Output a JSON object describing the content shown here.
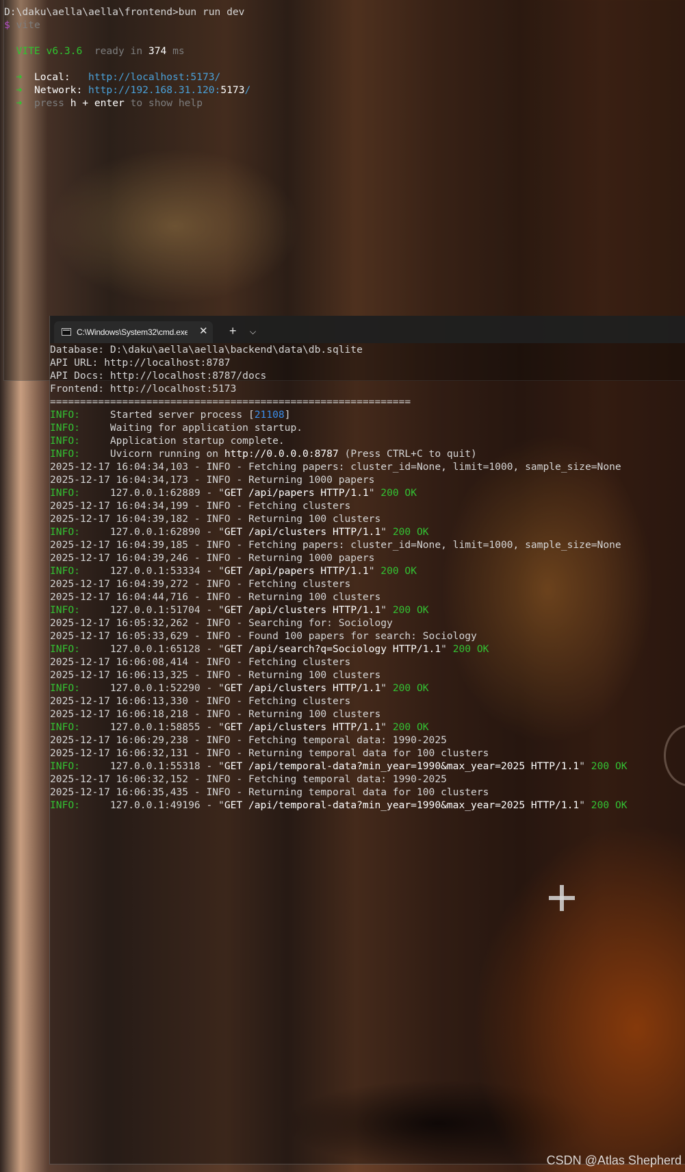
{
  "terminal_vite": {
    "command_line": "D:\\daku\\aella\\aella\\frontend>bun run dev",
    "script": {
      "symbol": "$",
      "name": "vite"
    },
    "ready": {
      "name": "VITE",
      "version": "v6.3.6",
      "text": "ready in",
      "ms": "374",
      "unit": "ms"
    },
    "arrow": "➜",
    "local": {
      "label": "Local:",
      "url": "http://localhost:5173/"
    },
    "network": {
      "label": "Network:",
      "url_host": "http://192.168.31.120:",
      "url_port": "5173",
      "url_slash": "/"
    },
    "help": {
      "press": "press",
      "keys": "h + enter",
      "rest": "to show help"
    }
  },
  "terminal_backend": {
    "tab": {
      "title": "C:\\Windows\\System32\\cmd.exe",
      "icon": "cmd-icon",
      "close": "✕"
    },
    "new_tab": "+",
    "dropdown": "⌵",
    "header_lines": [
      "Database: D:\\daku\\aella\\aella\\backend\\data\\db.sqlite",
      "API URL: http://localhost:8787",
      "API Docs: http://localhost:8787/docs",
      "Frontend: http://localhost:5173",
      "============================================================"
    ],
    "startup": {
      "level": "INFO:",
      "started_pre": "Started server process [",
      "pid": "21108",
      "started_post": "]",
      "waiting": "Waiting for application startup.",
      "complete": "Application startup complete.",
      "uvicorn_pre": "Uvicorn running on ",
      "uvicorn_url": "http://0.0.0.0:8787",
      "uvicorn_post": " (Press CTRL+C to quit)"
    },
    "log_lines": [
      {
        "type": "log",
        "text": "2025-12-17 16:04:34,103 - INFO - Fetching papers: cluster_id=None, limit=1000, sample_size=None"
      },
      {
        "type": "log",
        "text": "2025-12-17 16:04:34,173 - INFO - Returning 1000 papers"
      },
      {
        "type": "req",
        "level": "INFO:",
        "addr": "127.0.0.1:62889 - \"",
        "request": "GET /api/papers HTTP/1.1",
        "quote": "\"",
        "status": "200 OK"
      },
      {
        "type": "log",
        "text": "2025-12-17 16:04:34,199 - INFO - Fetching clusters"
      },
      {
        "type": "log",
        "text": "2025-12-17 16:04:39,182 - INFO - Returning 100 clusters"
      },
      {
        "type": "req",
        "level": "INFO:",
        "addr": "127.0.0.1:62890 - \"",
        "request": "GET /api/clusters HTTP/1.1",
        "quote": "\"",
        "status": "200 OK"
      },
      {
        "type": "log",
        "text": "2025-12-17 16:04:39,185 - INFO - Fetching papers: cluster_id=None, limit=1000, sample_size=None"
      },
      {
        "type": "log",
        "text": "2025-12-17 16:04:39,246 - INFO - Returning 1000 papers"
      },
      {
        "type": "req",
        "level": "INFO:",
        "addr": "127.0.0.1:53334 - \"",
        "request": "GET /api/papers HTTP/1.1",
        "quote": "\"",
        "status": "200 OK"
      },
      {
        "type": "log",
        "text": "2025-12-17 16:04:39,272 - INFO - Fetching clusters"
      },
      {
        "type": "log",
        "text": "2025-12-17 16:04:44,716 - INFO - Returning 100 clusters"
      },
      {
        "type": "req",
        "level": "INFO:",
        "addr": "127.0.0.1:51704 - \"",
        "request": "GET /api/clusters HTTP/1.1",
        "quote": "\"",
        "status": "200 OK"
      },
      {
        "type": "log",
        "text": "2025-12-17 16:05:32,262 - INFO - Searching for: Sociology"
      },
      {
        "type": "log",
        "text": "2025-12-17 16:05:33,629 - INFO - Found 100 papers for search: Sociology"
      },
      {
        "type": "req",
        "level": "INFO:",
        "addr": "127.0.0.1:65128 - \"",
        "request": "GET /api/search?q=Sociology HTTP/1.1",
        "quote": "\"",
        "status": "200 OK"
      },
      {
        "type": "log",
        "text": "2025-12-17 16:06:08,414 - INFO - Fetching clusters"
      },
      {
        "type": "log",
        "text": "2025-12-17 16:06:13,325 - INFO - Returning 100 clusters"
      },
      {
        "type": "req",
        "level": "INFO:",
        "addr": "127.0.0.1:52290 - \"",
        "request": "GET /api/clusters HTTP/1.1",
        "quote": "\"",
        "status": "200 OK"
      },
      {
        "type": "log",
        "text": "2025-12-17 16:06:13,330 - INFO - Fetching clusters"
      },
      {
        "type": "log",
        "text": "2025-12-17 16:06:18,218 - INFO - Returning 100 clusters"
      },
      {
        "type": "req",
        "level": "INFO:",
        "addr": "127.0.0.1:58855 - \"",
        "request": "GET /api/clusters HTTP/1.1",
        "quote": "\"",
        "status": "200 OK"
      },
      {
        "type": "log",
        "text": "2025-12-17 16:06:29,238 - INFO - Fetching temporal data: 1990-2025"
      },
      {
        "type": "log",
        "text": "2025-12-17 16:06:32,131 - INFO - Returning temporal data for 100 clusters"
      },
      {
        "type": "req",
        "level": "INFO:",
        "addr": "127.0.0.1:55318 - \"",
        "request": "GET /api/temporal-data?min_year=1990&max_year=2025 HTTP/1.1",
        "quote": "\"",
        "status": "200 OK"
      },
      {
        "type": "log",
        "text": "2025-12-17 16:06:32,152 - INFO - Fetching temporal data: 1990-2025"
      },
      {
        "type": "log",
        "text": "2025-12-17 16:06:35,435 - INFO - Returning temporal data for 100 clusters"
      },
      {
        "type": "req",
        "level": "INFO:",
        "addr": "127.0.0.1:49196 - \"",
        "request": "GET /api/temporal-data?min_year=1990&max_year=2025 HTTP/1.1",
        "quote": "\"",
        "status": "200 OK"
      }
    ]
  },
  "watermark": "CSDN @Atlas Shepherd",
  "colors": {
    "info_green": "#33c233",
    "pid_blue": "#3b8eea",
    "link_blue": "#4aa0d8",
    "prompt_purple": "#b04fc4"
  }
}
